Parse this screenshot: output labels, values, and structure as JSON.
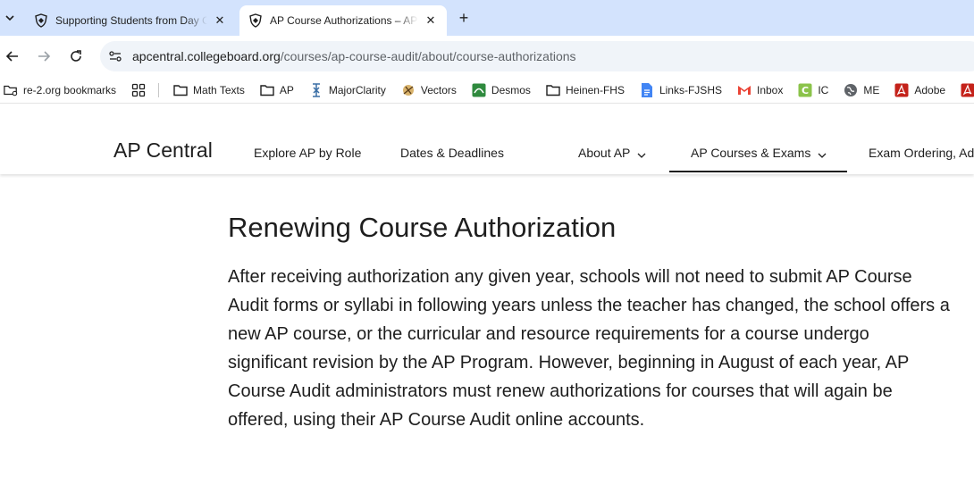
{
  "browser": {
    "tabs": [
      {
        "title": "Supporting Students from Day One to Exam Day",
        "active": false
      },
      {
        "title": "AP Course Authorizations – AP Central",
        "active": true
      }
    ],
    "address": {
      "host": "apcentral.collegeboard.org",
      "path": "/courses/ap-course-audit/about/course-authorizations"
    },
    "bookmarks": [
      {
        "label": "re-2.org bookmarks",
        "icon": "bookmark-manager-icon"
      },
      {
        "label": "",
        "icon": "apps-grid-icon"
      },
      {
        "label": "Math Texts",
        "icon": "folder-icon"
      },
      {
        "label": "AP",
        "icon": "folder-icon"
      },
      {
        "label": "MajorClarity",
        "icon": "majorclarity-icon"
      },
      {
        "label": "Vectors",
        "icon": "vectors-icon"
      },
      {
        "label": "Desmos",
        "icon": "desmos-icon"
      },
      {
        "label": "Heinen-FHS",
        "icon": "folder-icon"
      },
      {
        "label": "Links-FJSHS",
        "icon": "google-docs-icon"
      },
      {
        "label": "Inbox",
        "icon": "gmail-icon"
      },
      {
        "label": "IC",
        "icon": "ic-icon"
      },
      {
        "label": "ME",
        "icon": "globe-icon"
      },
      {
        "label": "Adobe",
        "icon": "adobe-icon"
      },
      {
        "label": "",
        "icon": "adobe-icon"
      }
    ]
  },
  "site": {
    "brand": "AP Central",
    "nav": [
      {
        "label": "Explore AP by Role",
        "dropdown": false
      },
      {
        "label": "Dates & Deadlines",
        "dropdown": false
      },
      {
        "label": "About AP",
        "dropdown": true
      },
      {
        "label": "AP Courses & Exams",
        "dropdown": true,
        "active": true
      },
      {
        "label": "Exam Ordering, Administration, and Scores",
        "dropdown": true
      }
    ]
  },
  "content": {
    "title": "Renewing Course Authorization",
    "body": "After receiving authorization any given year, schools will not need to submit AP Course Audit forms or syllabi in following years unless the teacher has changed, the school offers a new AP course, or the curricular and resource requirements for a course undergo significant revision by the AP Program. However, beginning in August of each year, AP Course Audit administrators must renew authorizations for courses that will again be offered, using their AP Course Audit online accounts."
  },
  "colors": {
    "tabstrip": "#d3e3fd",
    "text": "#1e1e1e",
    "omnibox": "#f0f4f9"
  }
}
